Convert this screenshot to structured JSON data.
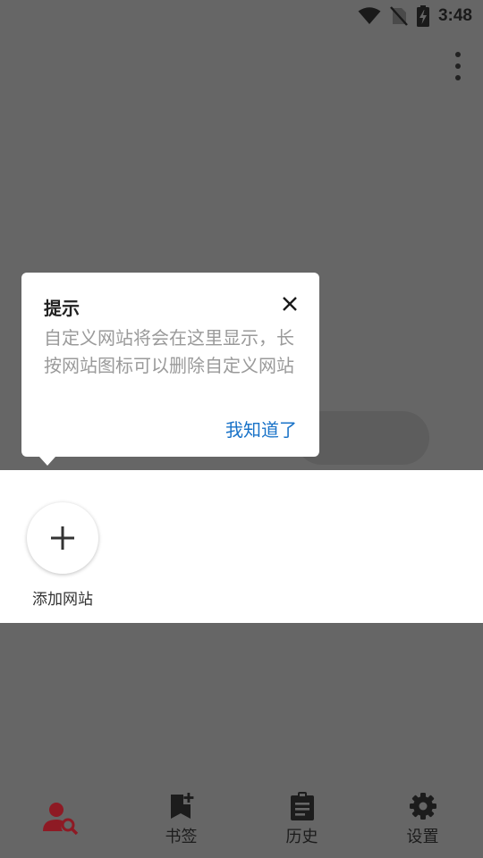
{
  "status_bar": {
    "time": "3:48",
    "icons": [
      "wifi-icon",
      "no-sim-icon",
      "battery-charging-icon"
    ]
  },
  "toolbar": {
    "menu_icon": "more-vert-icon"
  },
  "quick_sites": {
    "add_label": "添加网站",
    "add_icon": "plus-icon"
  },
  "tip_popup": {
    "title": "提示",
    "body": "自定义网站将会在这里显示，长按网站图标可以删除自定义网站",
    "confirm": "我知道了",
    "close_icon": "close-icon"
  },
  "bottom_nav": {
    "items": [
      {
        "label": "",
        "icon": "user-search-icon",
        "active": true
      },
      {
        "label": "书签",
        "icon": "bookmark-add-icon"
      },
      {
        "label": "历史",
        "icon": "clipboard-icon"
      },
      {
        "label": "设置",
        "icon": "gear-icon"
      }
    ],
    "active_color": "#8e1a24",
    "icon_color": "#1c1c1c"
  },
  "colors": {
    "overlay": "#666666",
    "link": "#1a73c8"
  }
}
